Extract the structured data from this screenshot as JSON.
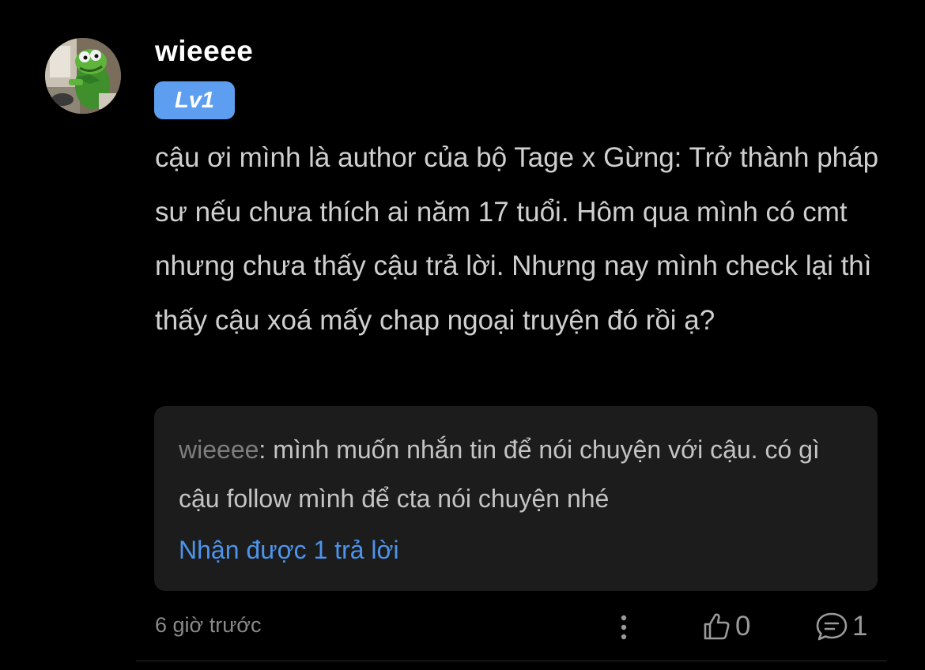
{
  "comment": {
    "username": "wieeee",
    "level": "Lv1",
    "body": "cậu ơi mình là author của bộ Tage x Gừng: Trở thành pháp sư nếu chưa thích ai năm 17 tuổi. Hôm qua mình có cmt nhưng chưa thấy cậu trả lời. Nhưng nay mình check lại thì thấy cậu xoá mấy chap ngoại truyện đó rồi ạ?",
    "timestamp": "6 giờ trước",
    "like_count": "0",
    "reply_count": "1"
  },
  "reply_preview": {
    "author": "wieeee",
    "text": ": mình muốn nhắn tin để nói chuyện với cậu. có gì cậu follow mình để cta nói chuyện nhé",
    "view_replies_label": "Nhận được 1 trả lời"
  },
  "icons": {
    "avatar": "kermit-frog-avatar",
    "more": "more-vertical-icon",
    "like": "thumbs-up-icon",
    "comment": "comment-bubble-icon"
  },
  "colors": {
    "background": "#000000",
    "badge": "#5d9ef0",
    "link": "#4d94ec",
    "reply_box": "#1c1c1c"
  }
}
